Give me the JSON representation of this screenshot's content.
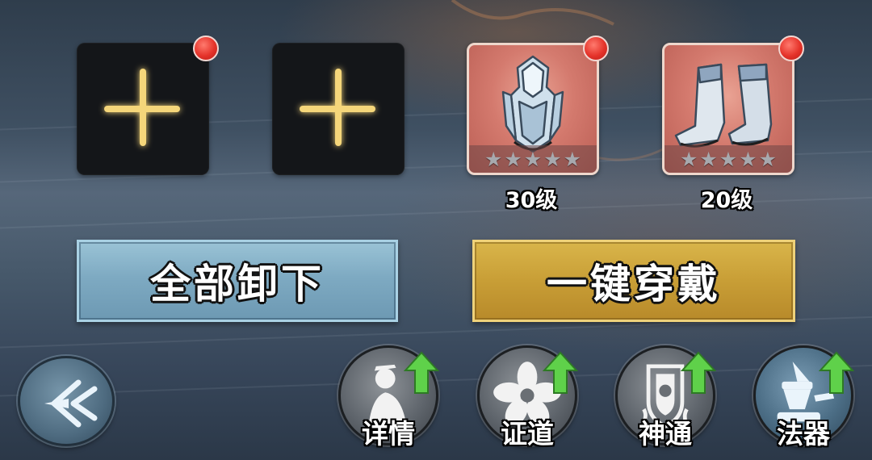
{
  "slots": [
    {
      "state": "empty",
      "has_red_dot": true
    },
    {
      "state": "empty",
      "has_red_dot": false
    },
    {
      "state": "equipped",
      "item_icon": "armor-icon",
      "level": "30级",
      "stars": 5,
      "has_red_dot": true
    },
    {
      "state": "equipped",
      "item_icon": "boots-icon",
      "level": "20级",
      "stars": 5,
      "has_red_dot": true
    }
  ],
  "buttons": {
    "unequip_all": "全部卸下",
    "equip_all": "一键穿戴"
  },
  "nav": [
    {
      "label": "详情",
      "icon": "character-icon",
      "has_upgrade_arrow": true
    },
    {
      "label": "证道",
      "icon": "flower-icon",
      "has_upgrade_arrow": true
    },
    {
      "label": "神通",
      "icon": "shield-emblem-icon",
      "has_upgrade_arrow": true
    },
    {
      "label": "法器",
      "icon": "artifact-icon",
      "has_upgrade_arrow": true
    }
  ],
  "back_icon": "back-arrow-icon",
  "colors": {
    "empty_slot": "#141619",
    "equipped_slot": "#d47a6e",
    "plus_glow": "#f5d67a",
    "red_dot": "#e5332a",
    "button_blue": "#7eaac2",
    "button_gold": "#c89e36",
    "upgrade_arrow": "#5fd14a"
  }
}
